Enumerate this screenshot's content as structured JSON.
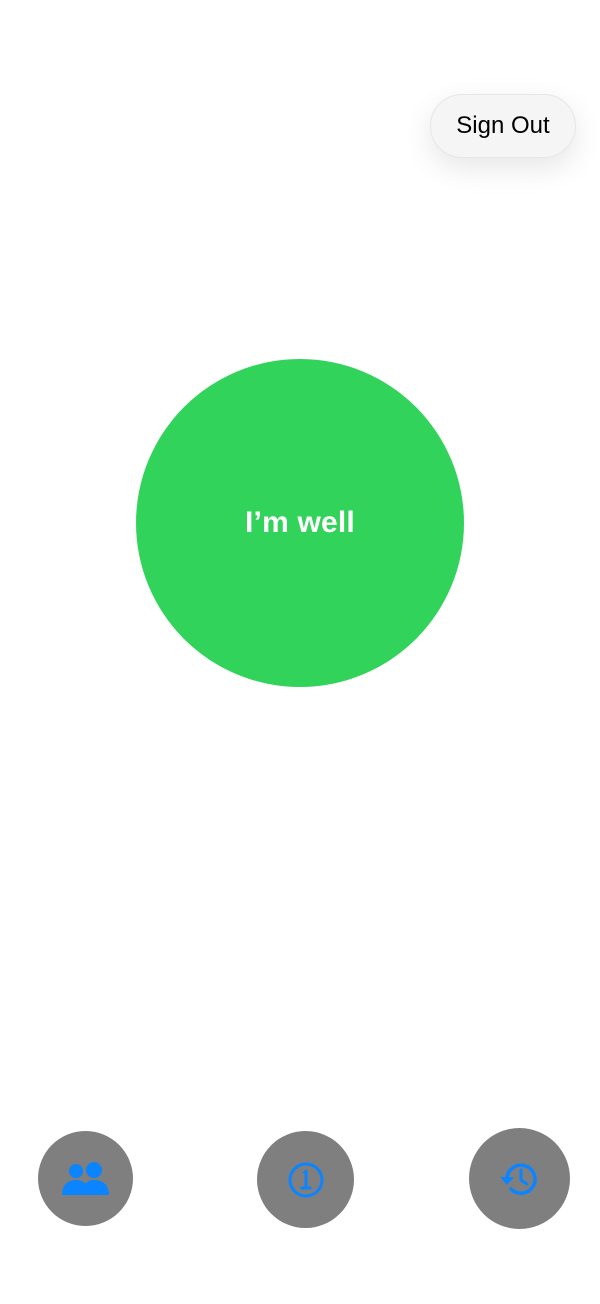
{
  "header": {
    "sign_out_label": "Sign Out"
  },
  "status": {
    "label": "I’m well",
    "color": "#32d35a"
  },
  "bottom_bar": {
    "buttons": [
      {
        "icon": "contacts-icon"
      },
      {
        "icon": "info-icon"
      },
      {
        "icon": "history-icon"
      }
    ],
    "button_color": "#7f7f7f",
    "icon_color": "#0a84ff"
  }
}
